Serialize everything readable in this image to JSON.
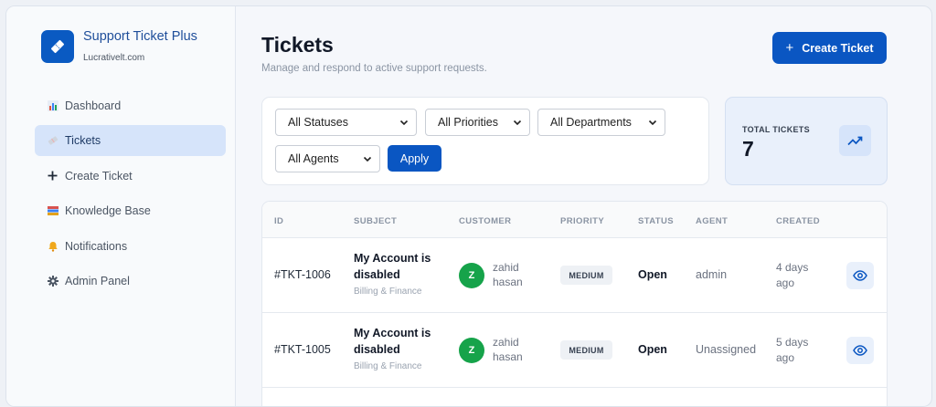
{
  "brand": {
    "name": "Support Ticket Plus",
    "subtitle": "Lucrativelt.com"
  },
  "sidebar": {
    "items": [
      {
        "label": "Dashboard",
        "icon": "bar-chart-icon",
        "active": false
      },
      {
        "label": "Tickets",
        "icon": "ticket-icon",
        "active": true
      },
      {
        "label": "Create Ticket",
        "icon": "plus-icon",
        "active": false
      },
      {
        "label": "Knowledge Base",
        "icon": "books-icon",
        "active": false
      },
      {
        "label": "Notifications",
        "icon": "bell-icon",
        "active": false
      },
      {
        "label": "Admin Panel",
        "icon": "gear-icon",
        "active": false
      }
    ]
  },
  "header": {
    "title": "Tickets",
    "subtitle": "Manage and respond to active support requests.",
    "create_label": "Create Ticket"
  },
  "filters": {
    "status": "All Statuses",
    "priority": "All Priorities",
    "department": "All Departments",
    "agent": "All Agents",
    "apply_label": "Apply"
  },
  "stats": {
    "label": "TOTAL TICKETS",
    "value": "7"
  },
  "table": {
    "headers": [
      "ID",
      "SUBJECT",
      "CUSTOMER",
      "PRIORITY",
      "STATUS",
      "AGENT",
      "CREATED"
    ],
    "rows": [
      {
        "id": "#TKT-1006",
        "subject": "My Account is disabled",
        "category": "Billing & Finance",
        "avatar_initial": "Z",
        "customer": "zahid hasan",
        "priority": "MEDIUM",
        "status": "Open",
        "agent": "admin",
        "created": "4 days ago"
      },
      {
        "id": "#TKT-1005",
        "subject": "My Account is disabled",
        "category": "Billing & Finance",
        "avatar_initial": "Z",
        "customer": "zahid hasan",
        "priority": "MEDIUM",
        "status": "Open",
        "agent": "Unassigned",
        "created": "5 days ago"
      }
    ]
  },
  "colors": {
    "primary": "#0a56c2",
    "active_nav": "#d6e4fa",
    "avatar": "#16a34a"
  }
}
